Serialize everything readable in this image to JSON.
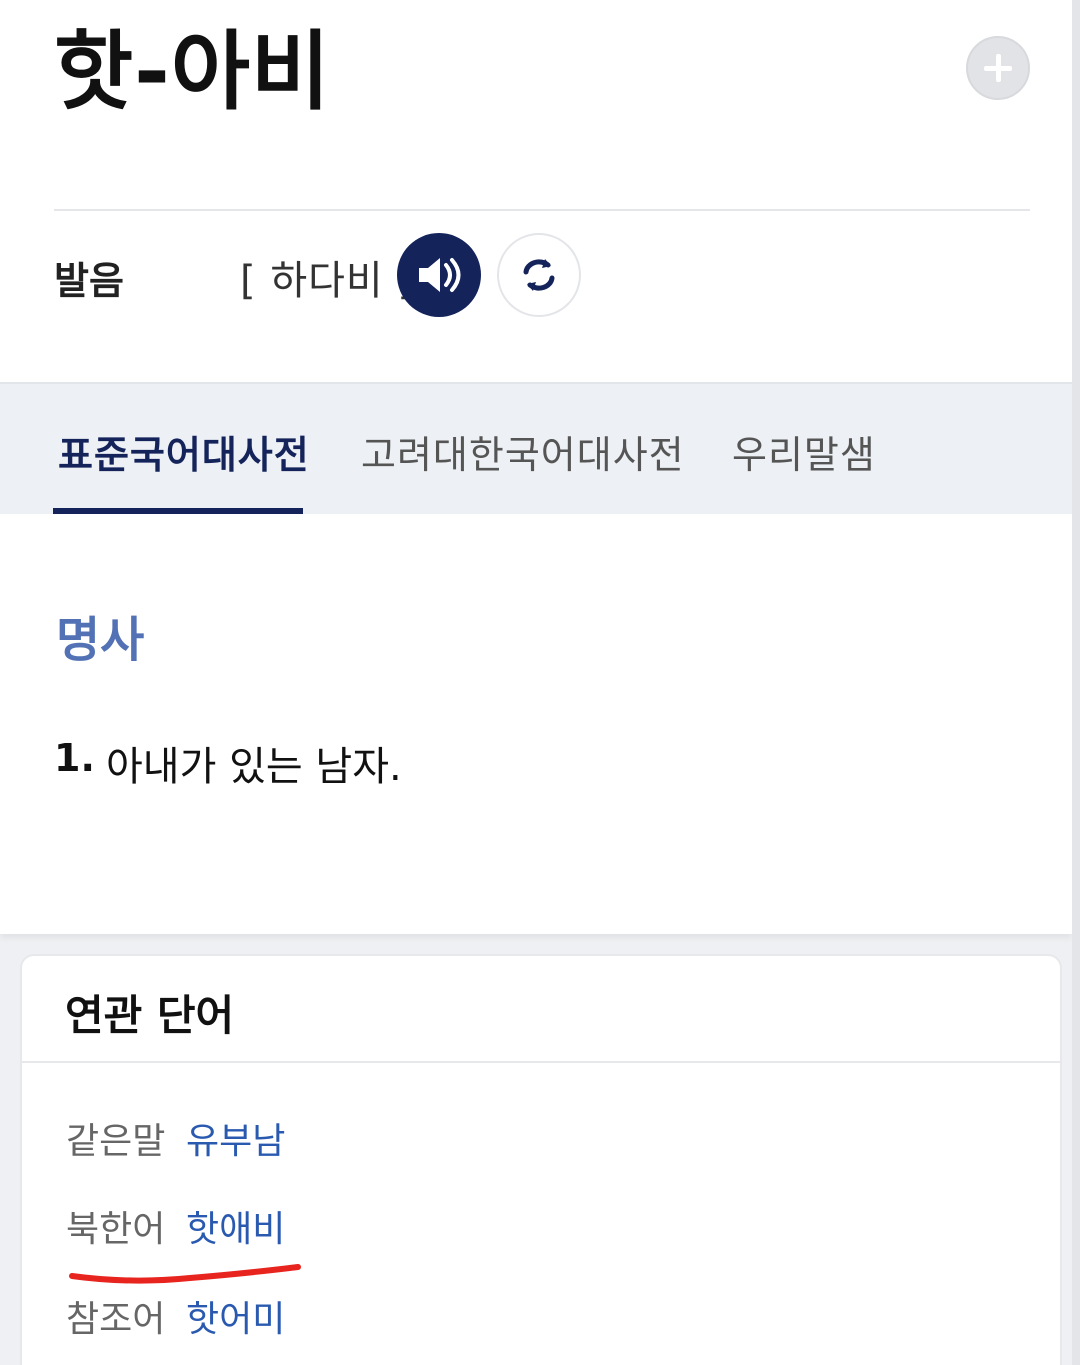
{
  "entry": {
    "word": "핫-아비",
    "add_icon": "plus-icon"
  },
  "pronunciation": {
    "label": "발음",
    "text": "[ 하다비 ]",
    "speaker_icon": "speaker-icon",
    "replay_icon": "replay-icon"
  },
  "tabs": [
    {
      "label": "표준국어대사전",
      "active": true
    },
    {
      "label": "고려대한국어대사전",
      "active": false
    },
    {
      "label": "우리말샘",
      "active": false
    }
  ],
  "definition": {
    "part_of_speech": "명사",
    "senses": [
      {
        "number": "1.",
        "text": "아내가 있는 남자."
      }
    ]
  },
  "related": {
    "title": "연관 단어",
    "rows": [
      {
        "label": "같은말",
        "word": "유부남"
      },
      {
        "label": "북한어",
        "word": "핫애비"
      },
      {
        "label": "참조어",
        "word": "핫어미"
      }
    ]
  },
  "colors": {
    "navy": "#14235a",
    "pos_blue": "#5272b5",
    "link_blue": "#2a5ab0",
    "annotation_red": "#e8241f"
  }
}
